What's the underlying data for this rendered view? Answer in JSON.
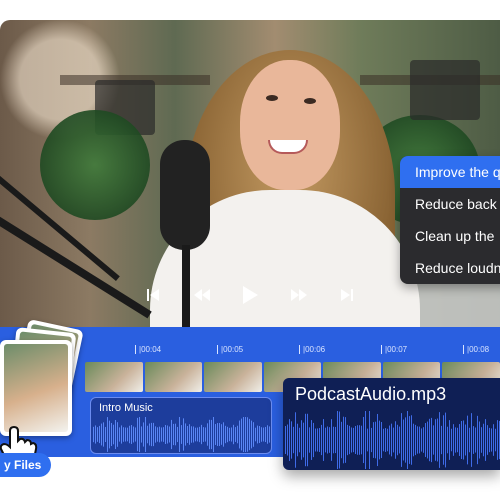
{
  "player": {
    "controls": [
      {
        "name": "skip-back-icon"
      },
      {
        "name": "rewind-icon"
      },
      {
        "name": "play-icon"
      },
      {
        "name": "fast-forward-icon"
      },
      {
        "name": "skip-forward-icon"
      }
    ]
  },
  "ai_menu": {
    "items": [
      {
        "label": "Improve the q",
        "active": true
      },
      {
        "label": "Reduce back",
        "active": false
      },
      {
        "label": "Clean up the",
        "active": false
      },
      {
        "label": "Reduce loudn",
        "active": false
      }
    ]
  },
  "timeline": {
    "ticks": [
      "|00:04",
      "|00:05",
      "|00:06",
      "|00:07",
      "|00:08"
    ],
    "accent": "#2a5fe0",
    "clips": {
      "intro": {
        "label": "Intro Music",
        "color": "#1d3d9c",
        "wave_color": "#5a86f5"
      },
      "podcast": {
        "label": "PodcastAudio.mp3",
        "color": "#0f1f55",
        "wave_color": "#3f6be8"
      }
    }
  },
  "files": {
    "label": "y Files"
  }
}
